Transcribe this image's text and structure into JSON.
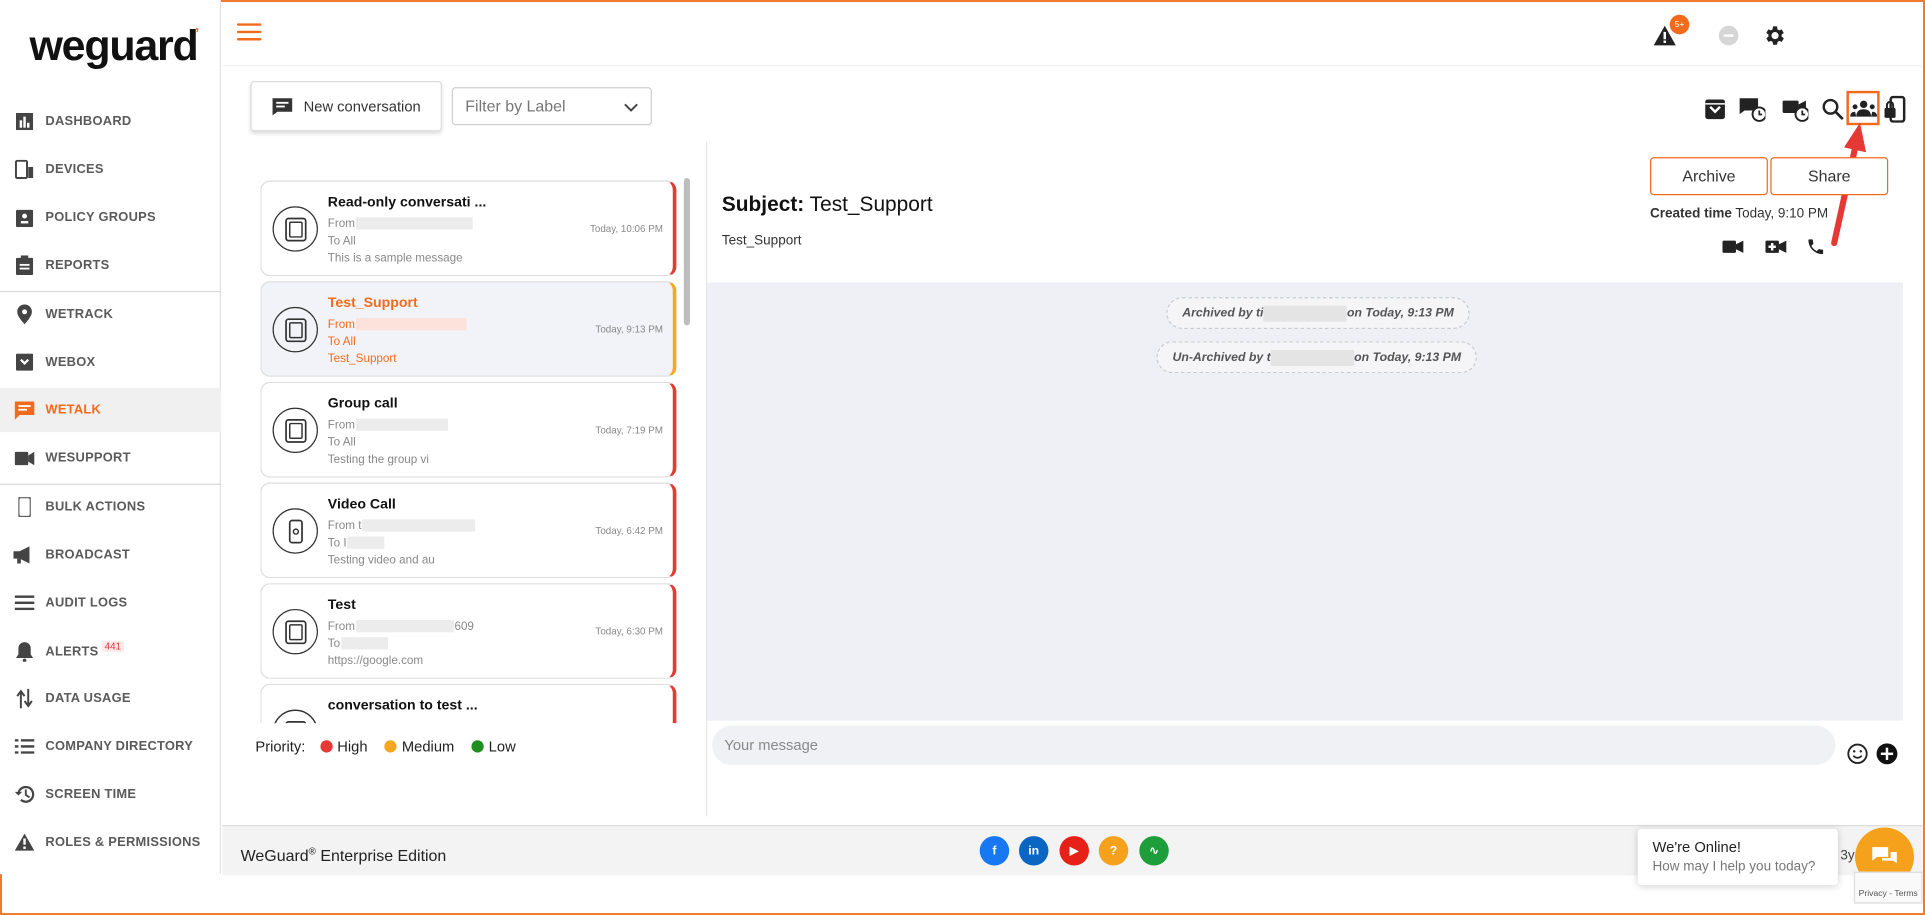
{
  "app": {
    "logo_text": "weguard",
    "logo_accent_mark": "’"
  },
  "sidebar": {
    "items": [
      {
        "label": "DASHBOARD",
        "icon": "bar-chart-icon"
      },
      {
        "label": "DEVICES",
        "icon": "devices-icon"
      },
      {
        "label": "POLICY GROUPS",
        "icon": "policy-icon"
      },
      {
        "label": "REPORTS",
        "icon": "clipboard-icon"
      },
      {
        "label": "WETRACK",
        "icon": "location-pin-icon"
      },
      {
        "label": "WEBOX",
        "icon": "download-box-icon"
      },
      {
        "label": "WETALK",
        "icon": "chat-icon",
        "active": true
      },
      {
        "label": "WESUPPORT",
        "icon": "video-camera-icon"
      },
      {
        "label": "BULK ACTIONS",
        "icon": "phone-icon"
      },
      {
        "label": "BROADCAST",
        "icon": "megaphone-icon"
      },
      {
        "label": "AUDIT LOGS",
        "icon": "list-icon"
      },
      {
        "label": "ALERTS",
        "icon": "bell-icon",
        "badge": "441"
      },
      {
        "label": "DATA USAGE",
        "icon": "transfer-icon"
      },
      {
        "label": "COMPANY DIRECTORY",
        "icon": "directory-icon"
      },
      {
        "label": "SCREEN TIME",
        "icon": "history-icon"
      },
      {
        "label": "ROLES & PERMISSIONS",
        "icon": "warning-icon"
      }
    ]
  },
  "header": {
    "notification_badge": "5+"
  },
  "toolbar": {
    "new_conversation_label": "New conversation",
    "filter_placeholder": "Filter by Label",
    "icons": [
      "archive-box-icon",
      "scheduled-message-icon",
      "scheduled-video-icon",
      "search-icon",
      "group-icon",
      "lock-device-icon"
    ]
  },
  "conversations": [
    {
      "title": "Read-only conversati ...",
      "from": "From",
      "to": "To All",
      "preview": "This is a sample message",
      "time": "Today, 10:06 PM",
      "priority": "High"
    },
    {
      "title": "Test_Support",
      "from": "From",
      "to": "To All",
      "preview": "Test_Support",
      "time": "Today, 9:13 PM",
      "priority": "Medium",
      "selected": true
    },
    {
      "title": "Group call",
      "from": "From",
      "to": "To All",
      "preview": "Testing the group vi",
      "time": "Today, 7:19 PM",
      "priority": "High"
    },
    {
      "title": "Video Call",
      "from": "From t",
      "to": "To I",
      "preview": "Testing video and au",
      "time": "Today, 6:42 PM",
      "priority": "High"
    },
    {
      "title": "Test",
      "from": "From",
      "from_suffix": "609",
      "to": "To",
      "preview": "https://google.com",
      "time": "Today, 6:30 PM",
      "priority": "High"
    },
    {
      "title": "conversation to test ...",
      "from": "",
      "to": "",
      "preview": "",
      "time": "",
      "priority": "High"
    }
  ],
  "priority_legend": {
    "label": "Priority:",
    "items": [
      {
        "label": "High",
        "color": "#e53935"
      },
      {
        "label": "Medium",
        "color": "#f5a623"
      },
      {
        "label": "Low",
        "color": "#1e8e1e"
      }
    ]
  },
  "detail": {
    "subject_label": "Subject:",
    "subject": "Test_Support",
    "subtitle": "Test_Support",
    "archive_label": "Archive",
    "share_label": "Share",
    "created_label": "Created time",
    "created_value": "Today, 9:10 PM",
    "events": [
      {
        "prefix": "Archived by ti",
        "suffix": "on Today, 9:13 PM"
      },
      {
        "prefix": "Un-Archived by t",
        "suffix": "on Today, 9:13 PM"
      }
    ],
    "composer_placeholder": "Your message"
  },
  "footer": {
    "brand": "WeGuard",
    "reg": "®",
    "edition": " Enterprise Edition",
    "social": [
      {
        "name": "facebook-icon",
        "glyph": "f",
        "color": "#1877f2"
      },
      {
        "name": "linkedin-icon",
        "glyph": "in",
        "color": "#0a66c2"
      },
      {
        "name": "youtube-icon",
        "glyph": "▶",
        "color": "#e62117"
      },
      {
        "name": "help-icon",
        "glyph": "?",
        "color": "#f5a11b"
      },
      {
        "name": "status-icon",
        "glyph": "∿",
        "color": "#1e9e3a"
      }
    ],
    "partial_text": "3y"
  },
  "chat_widget": {
    "title": "We're Online!",
    "subtitle": "How may I help you today?"
  },
  "recaptcha": {
    "text": "Privacy - Terms"
  }
}
